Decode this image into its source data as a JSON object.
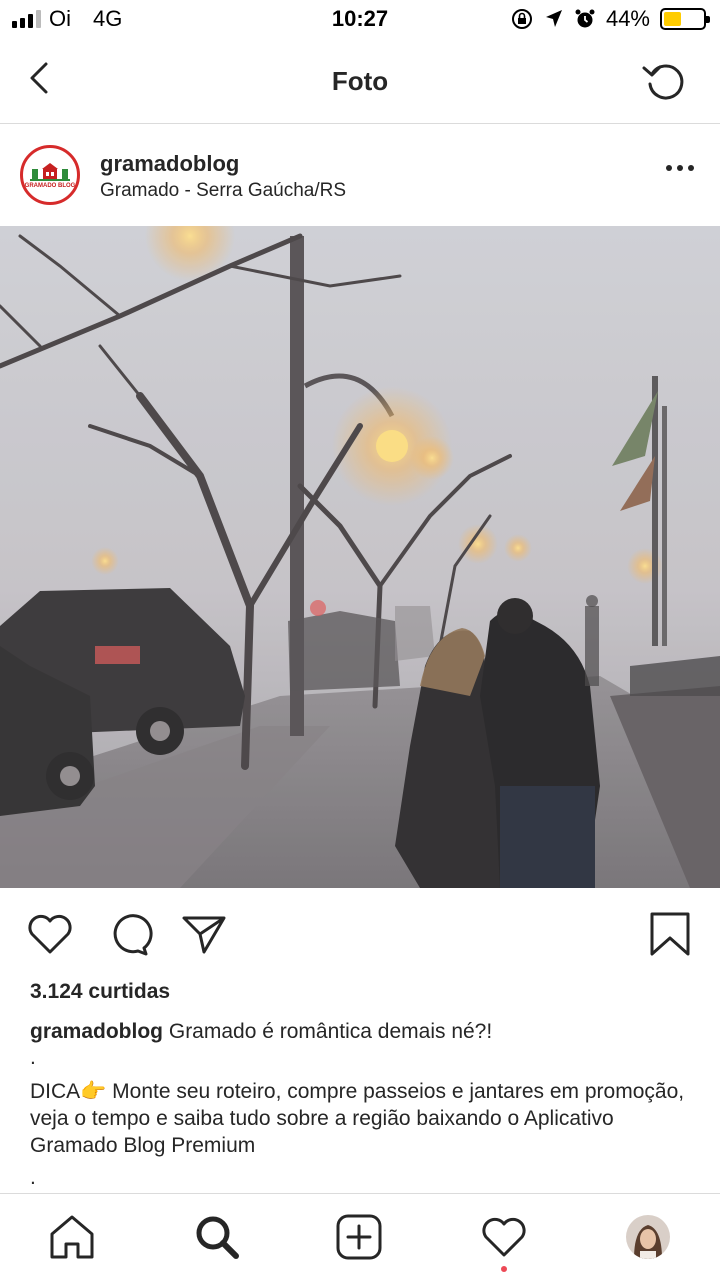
{
  "status_bar": {
    "carrier": "Oi",
    "network": "4G",
    "time": "10:27",
    "battery_percent": "44%",
    "battery_level": 0.44,
    "battery_color": "#ffcc00"
  },
  "nav": {
    "title": "Foto",
    "back_icon": "chevron-left-icon",
    "refresh_icon": "refresh-icon"
  },
  "post": {
    "username": "gramadoblog",
    "location": "Gramado - Serra Gaúcha/RS",
    "avatar_text": "GRAMADO BLOG",
    "likes": "3.124 curtidas",
    "caption_user": "gramadoblog",
    "caption_text": "Gramado é romântica demais né?!",
    "dot_1": ".",
    "tip": "DICA👉 Monte seu roteiro, compre passeios e jantares em promoção, veja o tempo e saiba tudo sobre a região baixando o Aplicativo Gramado Blog Premium",
    "dot_2": "."
  },
  "actions": [
    "heart-icon",
    "comment-icon",
    "share-icon",
    "bookmark-icon"
  ],
  "tabbar": [
    "home-icon",
    "search-icon",
    "add-post-icon",
    "activity-heart-icon",
    "profile-avatar"
  ],
  "colors": {
    "accent_red": "#ed4956",
    "brand_red": "#d62b2b",
    "text": "#262626",
    "divider": "#dbdbdb"
  }
}
